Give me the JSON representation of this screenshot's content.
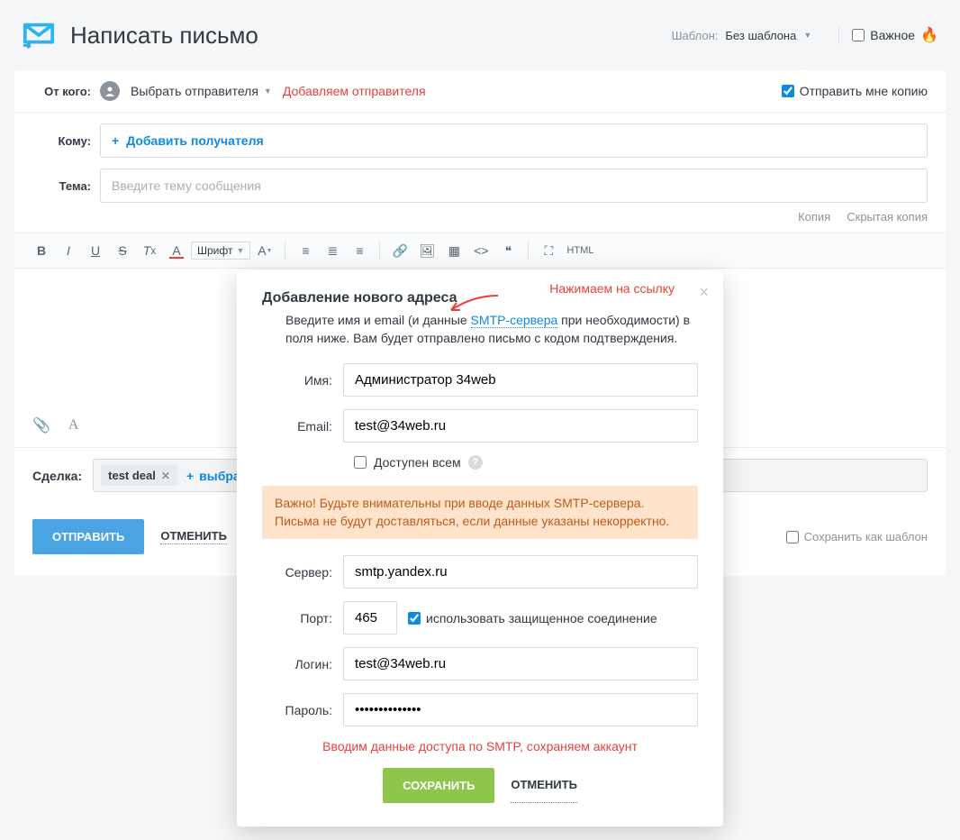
{
  "header": {
    "title": "Написать письмо",
    "template_label": "Шаблон:",
    "template_value": "Без шаблона",
    "important_label": "Важное"
  },
  "compose": {
    "from_label": "От кого:",
    "sender_select": "Выбрать отправителя",
    "add_sender_note": "Добавляем отправителя",
    "cc_me": "Отправить мне копию",
    "to_label": "Кому:",
    "add_recipient": "Добавить получателя",
    "subject_label": "Тема:",
    "subject_placeholder": "Введите тему сообщения",
    "copy_link": "Копия",
    "bcc_link": "Скрытая копия",
    "deal_label": "Сделка:",
    "deal_chip": "test deal",
    "deal_add": "выбра",
    "send_btn": "ОТПРАВИТЬ",
    "cancel_btn": "ОТМЕНИТЬ",
    "save_template": "Сохранить как шаблон"
  },
  "toolbar": {
    "font_label": "Шрифт",
    "html_label": "HTML"
  },
  "modal": {
    "title": "Добавление нового адреса",
    "annotation_link": "Нажимаем на ссылку",
    "desc_pre": "Введите имя и email (и данные ",
    "smtp_link": "SMTP-сервера",
    "desc_post": " при необходимости) в поля ниже. Вам будет отправлено письмо с кодом подтверждения.",
    "name_label": "Имя:",
    "name_value": "Администратор 34web",
    "email_label": "Email:",
    "email_value": "test@34web.ru",
    "available_label": "Доступен всем",
    "warning": "Важно! Будьте внимательны при вводе данных SMTP-сервера. Письма не будут доставляться, если данные указаны некорректно.",
    "server_label": "Сервер:",
    "server_value": "smtp.yandex.ru",
    "port_label": "Порт:",
    "port_value": "465",
    "secure_label": "использовать защищенное соединение",
    "login_label": "Логин:",
    "login_value": "test@34web.ru",
    "password_label": "Пароль:",
    "password_value": "••••••••••••••",
    "red_note": "Вводим данные доступа по SMTP, сохраняем аккаунт",
    "save_btn": "СОХРАНИТЬ",
    "cancel_btn": "ОТМЕНИТЬ"
  }
}
